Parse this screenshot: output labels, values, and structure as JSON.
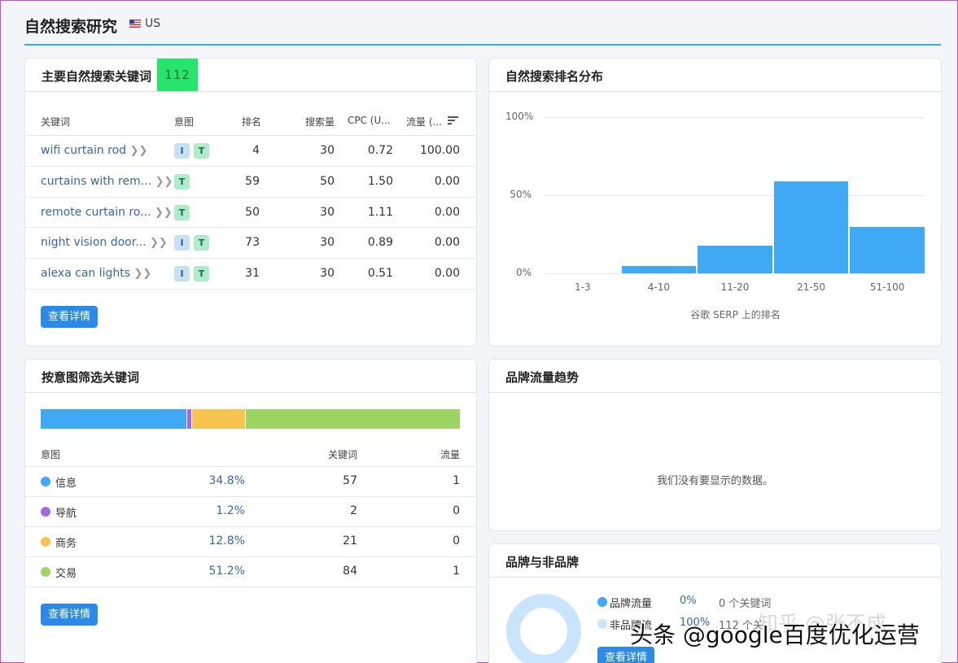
{
  "header": {
    "title": "自然搜索研究",
    "country": "US"
  },
  "keywords_card": {
    "title": "主要自然搜索关键词",
    "count": "112",
    "columns": [
      "关键词",
      "意图",
      "排名",
      "搜索量",
      "CPC (U...",
      "流量 (..."
    ],
    "rows": [
      {
        "keyword": "wifi curtain rod",
        "intents": [
          "I",
          "T"
        ],
        "rank": "4",
        "volume": "30",
        "cpc": "0.72",
        "traffic": "100.00"
      },
      {
        "keyword": "curtains with rem...",
        "intents": [
          "T"
        ],
        "rank": "59",
        "volume": "50",
        "cpc": "1.50",
        "traffic": "0.00"
      },
      {
        "keyword": "remote curtain ro...",
        "intents": [
          "T"
        ],
        "rank": "50",
        "volume": "30",
        "cpc": "1.11",
        "traffic": "0.00"
      },
      {
        "keyword": "night vision door...",
        "intents": [
          "I",
          "T"
        ],
        "rank": "73",
        "volume": "30",
        "cpc": "0.89",
        "traffic": "0.00"
      },
      {
        "keyword": "alexa can lights",
        "intents": [
          "I",
          "T"
        ],
        "rank": "31",
        "volume": "30",
        "cpc": "0.51",
        "traffic": "0.00"
      }
    ],
    "details_button": "查看详情"
  },
  "ranking_card": {
    "title": "自然搜索排名分布",
    "chart_data": {
      "type": "bar",
      "categories": [
        "1-3",
        "4-10",
        "11-20",
        "21-50",
        "51-100"
      ],
      "values": [
        0,
        4.5,
        17.9,
        58.9,
        29.5
      ],
      "y_ticks": [
        "100%",
        "50%",
        "0%"
      ],
      "ylim": [
        0,
        100
      ],
      "xlabel": "谷歌 SERP 上的排名",
      "color": "#3fa9f5"
    }
  },
  "intent_card": {
    "title": "按意图筛选关键词",
    "columns": [
      "意图",
      "关键词",
      "流量"
    ],
    "rows": [
      {
        "name": "信息",
        "percent": "34.8%",
        "keywords": "57",
        "traffic": "1",
        "color": "#3fa9f5"
      },
      {
        "name": "导航",
        "percent": "1.2%",
        "keywords": "2",
        "traffic": "0",
        "color": "#a36be0"
      },
      {
        "name": "商务",
        "percent": "12.8%",
        "keywords": "21",
        "traffic": "0",
        "color": "#f7c44f"
      },
      {
        "name": "交易",
        "percent": "51.2%",
        "keywords": "84",
        "traffic": "1",
        "color": "#9ed462"
      }
    ],
    "details_button": "查看详情"
  },
  "brand_trend_card": {
    "title": "品牌流量趋势",
    "empty_message": "我们没有要显示的数据。"
  },
  "brand_card": {
    "title": "品牌与非品牌",
    "legend": [
      {
        "label": "品牌流量",
        "percent": "0%",
        "count": "0 个关键词",
        "color": "#3fa9f5"
      },
      {
        "label": "非品牌流",
        "percent": "100%",
        "count": "112 个关",
        "color": "#c9e5fb"
      }
    ],
    "details_button": "查看详情"
  },
  "watermark": {
    "text": "头条 @google百度优化运营",
    "faint": "知乎 @张不成"
  }
}
